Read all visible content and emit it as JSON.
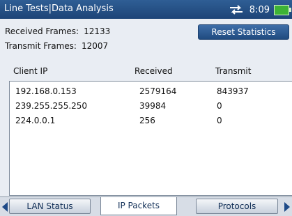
{
  "window": {
    "title": "Line Tests|Data Analysis",
    "time": "8:09",
    "network_icon": "network-arrows-icon",
    "battery_icon": "battery-icon",
    "battery_color": "#3db335"
  },
  "stats": {
    "received_label": "Received Frames:",
    "received_value": "12133",
    "transmit_label": "Transmit Frames:",
    "transmit_value": "12007",
    "reset_label": "Reset Statistics"
  },
  "table": {
    "headers": [
      "Client IP",
      "Received",
      "Transmit"
    ],
    "rows": [
      [
        "192.168.0.153",
        "2579164",
        "843937"
      ],
      [
        "239.255.255.250",
        "39984",
        "0"
      ],
      [
        "224.0.0.1",
        "256",
        "0"
      ]
    ]
  },
  "tabs": [
    {
      "label": "LAN Status",
      "active": false
    },
    {
      "label": "IP Packets",
      "active": true
    },
    {
      "label": "Protocols",
      "active": false
    }
  ]
}
